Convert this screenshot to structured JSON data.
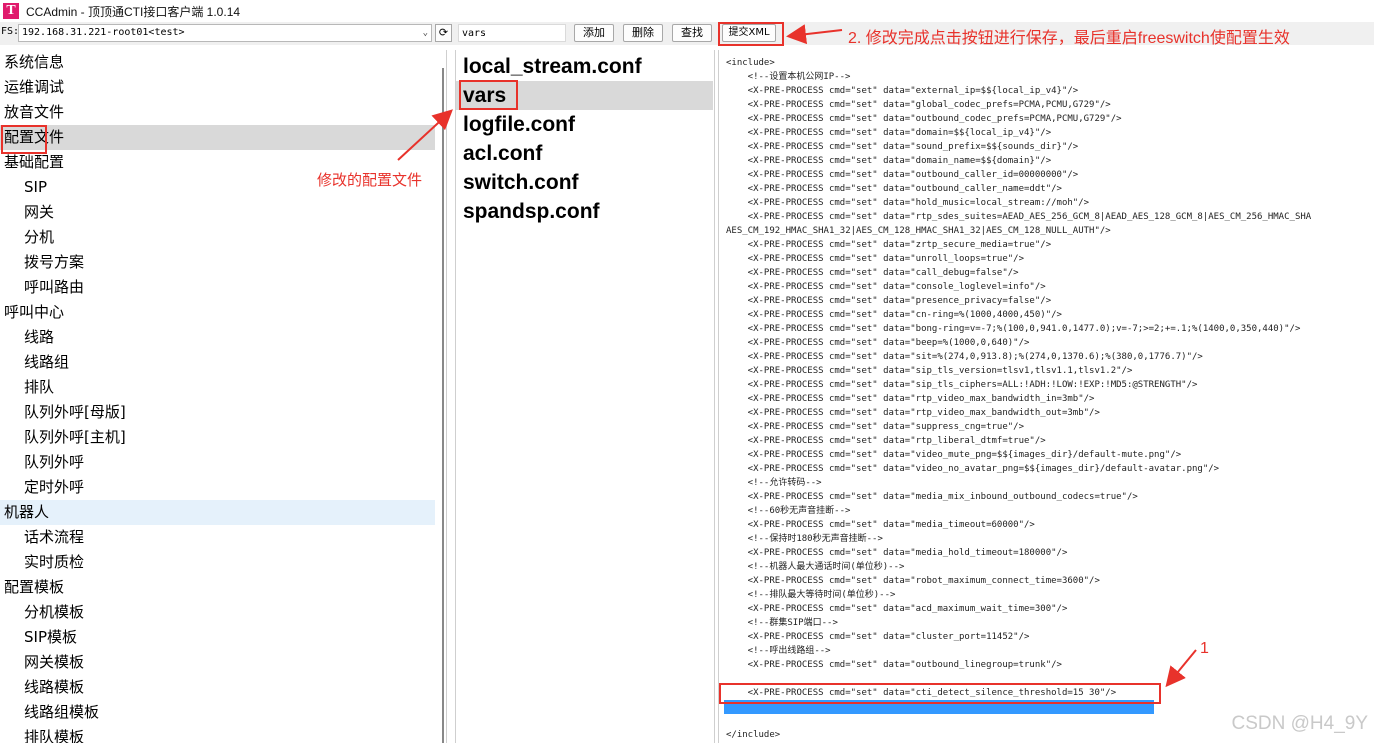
{
  "window": {
    "title": "CCAdmin - 顶顶通CTI接口客户端 1.0.14",
    "icon_letter": "T"
  },
  "toolbar": {
    "fs_label": "FS:",
    "fs_value": "192.168.31.221-root01<test>",
    "refresh_glyph": "⟳",
    "search_value": "vars",
    "add_label": "添加",
    "delete_label": "删除",
    "find_label": "查找",
    "submit_label": "提交XML"
  },
  "nav": {
    "items": [
      {
        "label": "系统信息",
        "level": 0
      },
      {
        "label": "运维调试",
        "level": 0
      },
      {
        "label": "放音文件",
        "level": 0
      },
      {
        "label": "配置文件",
        "level": 0,
        "selected": true
      },
      {
        "label": "基础配置",
        "level": 0
      },
      {
        "label": "SIP",
        "level": 1
      },
      {
        "label": "网关",
        "level": 1
      },
      {
        "label": "分机",
        "level": 1
      },
      {
        "label": "拨号方案",
        "level": 1
      },
      {
        "label": "呼叫路由",
        "level": 1
      },
      {
        "label": "呼叫中心",
        "level": 0
      },
      {
        "label": "线路",
        "level": 1
      },
      {
        "label": "线路组",
        "level": 1
      },
      {
        "label": "排队",
        "level": 1
      },
      {
        "label": "队列外呼[母版]",
        "level": 1
      },
      {
        "label": "队列外呼[主机]",
        "level": 1
      },
      {
        "label": "队列外呼",
        "level": 1
      },
      {
        "label": "定时外呼",
        "level": 1
      },
      {
        "label": "机器人",
        "level": 0,
        "hover": true
      },
      {
        "label": "话术流程",
        "level": 1
      },
      {
        "label": "实时质检",
        "level": 1
      },
      {
        "label": "配置模板",
        "level": 0
      },
      {
        "label": "分机模板",
        "level": 1
      },
      {
        "label": "SIP模板",
        "level": 1
      },
      {
        "label": "网关模板",
        "level": 1
      },
      {
        "label": "线路模板",
        "level": 1
      },
      {
        "label": "线路组模板",
        "level": 1
      },
      {
        "label": "排队模板",
        "level": 1
      }
    ]
  },
  "files": {
    "items": [
      {
        "label": "local_stream.conf"
      },
      {
        "label": "vars",
        "selected": true
      },
      {
        "label": "logfile.conf"
      },
      {
        "label": "acl.conf"
      },
      {
        "label": "switch.conf"
      },
      {
        "label": "spandsp.conf"
      }
    ]
  },
  "xml": {
    "lines": [
      "<include>",
      "    <!--设置本机公网IP-->",
      "    <X-PRE-PROCESS cmd=\"set\" data=\"external_ip=$${local_ip_v4}\"/>",
      "    <X-PRE-PROCESS cmd=\"set\" data=\"global_codec_prefs=PCMA,PCMU,G729\"/>",
      "    <X-PRE-PROCESS cmd=\"set\" data=\"outbound_codec_prefs=PCMA,PCMU,G729\"/>",
      "    <X-PRE-PROCESS cmd=\"set\" data=\"domain=$${local_ip_v4}\"/>",
      "    <X-PRE-PROCESS cmd=\"set\" data=\"sound_prefix=$${sounds_dir}\"/>",
      "    <X-PRE-PROCESS cmd=\"set\" data=\"domain_name=$${domain}\"/>",
      "    <X-PRE-PROCESS cmd=\"set\" data=\"outbound_caller_id=00000000\"/>",
      "    <X-PRE-PROCESS cmd=\"set\" data=\"outbound_caller_name=ddt\"/>",
      "    <X-PRE-PROCESS cmd=\"set\" data=\"hold_music=local_stream://moh\"/>",
      "    <X-PRE-PROCESS cmd=\"set\" data=\"rtp_sdes_suites=AEAD_AES_256_GCM_8|AEAD_AES_128_GCM_8|AES_CM_256_HMAC_SHA",
      "AES_CM_192_HMAC_SHA1_32|AES_CM_128_HMAC_SHA1_32|AES_CM_128_NULL_AUTH\"/>",
      "    <X-PRE-PROCESS cmd=\"set\" data=\"zrtp_secure_media=true\"/>",
      "    <X-PRE-PROCESS cmd=\"set\" data=\"unroll_loops=true\"/>",
      "    <X-PRE-PROCESS cmd=\"set\" data=\"call_debug=false\"/>",
      "    <X-PRE-PROCESS cmd=\"set\" data=\"console_loglevel=info\"/>",
      "    <X-PRE-PROCESS cmd=\"set\" data=\"presence_privacy=false\"/>",
      "    <X-PRE-PROCESS cmd=\"set\" data=\"cn-ring=%(1000,4000,450)\"/>",
      "    <X-PRE-PROCESS cmd=\"set\" data=\"bong-ring=v=-7;%(100,0,941.0,1477.0);v=-7;>=2;+=.1;%(1400,0,350,440)\"/>",
      "    <X-PRE-PROCESS cmd=\"set\" data=\"beep=%(1000,0,640)\"/>",
      "    <X-PRE-PROCESS cmd=\"set\" data=\"sit=%(274,0,913.8);%(274,0,1370.6);%(380,0,1776.7)\"/>",
      "    <X-PRE-PROCESS cmd=\"set\" data=\"sip_tls_version=tlsv1,tlsv1.1,tlsv1.2\"/>",
      "    <X-PRE-PROCESS cmd=\"set\" data=\"sip_tls_ciphers=ALL:!ADH:!LOW:!EXP:!MD5:@STRENGTH\"/>",
      "    <X-PRE-PROCESS cmd=\"set\" data=\"rtp_video_max_bandwidth_in=3mb\"/>",
      "    <X-PRE-PROCESS cmd=\"set\" data=\"rtp_video_max_bandwidth_out=3mb\"/>",
      "    <X-PRE-PROCESS cmd=\"set\" data=\"suppress_cng=true\"/>",
      "    <X-PRE-PROCESS cmd=\"set\" data=\"rtp_liberal_dtmf=true\"/>",
      "    <X-PRE-PROCESS cmd=\"set\" data=\"video_mute_png=$${images_dir}/default-mute.png\"/>",
      "    <X-PRE-PROCESS cmd=\"set\" data=\"video_no_avatar_png=$${images_dir}/default-avatar.png\"/>",
      "    <!--允许转码-->",
      "    <X-PRE-PROCESS cmd=\"set\" data=\"media_mix_inbound_outbound_codecs=true\"/>",
      "    <!--60秒无声音挂断-->",
      "    <X-PRE-PROCESS cmd=\"set\" data=\"media_timeout=60000\"/>",
      "    <!--保持时180秒无声音挂断-->",
      "    <X-PRE-PROCESS cmd=\"set\" data=\"media_hold_timeout=180000\"/>",
      "    <!--机器人最大通话时间(单位秒)-->",
      "    <X-PRE-PROCESS cmd=\"set\" data=\"robot_maximum_connect_time=3600\"/>",
      "    <!--排队最大等待时间(单位秒)-->",
      "    <X-PRE-PROCESS cmd=\"set\" data=\"acd_maximum_wait_time=300\"/>",
      "    <!--群集SIP端口-->",
      "    <X-PRE-PROCESS cmd=\"set\" data=\"cluster_port=11452\"/>",
      "    <!--呼出线路组-->",
      "    <X-PRE-PROCESS cmd=\"set\" data=\"outbound_linegroup=trunk\"/>",
      "",
      "    <X-PRE-PROCESS cmd=\"set\" data=\"cti_detect_silence_threshold=15 30\"/>",
      "",
      "",
      "</include>"
    ],
    "highlighted_line_index": 46
  },
  "annotations": {
    "nav_note": "修改的配置文件",
    "submit_note": "2. 修改完成点击按钮进行保存，最后重启freeswitch使配置生效",
    "line_note": "1",
    "color": "#e8322b"
  },
  "watermark": "CSDN @H4_9Y"
}
